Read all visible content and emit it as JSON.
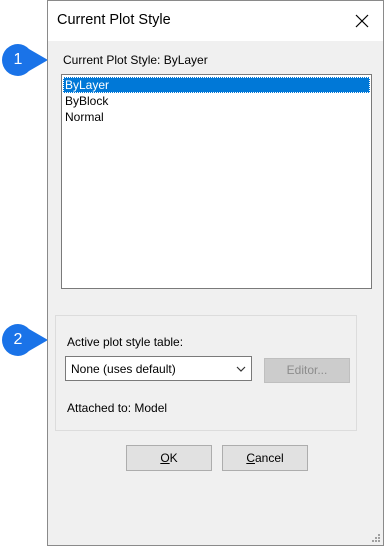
{
  "window": {
    "title": "Current Plot Style"
  },
  "current_style_label": "Current Plot Style: ByLayer",
  "plot_styles": [
    {
      "label": "ByLayer",
      "selected": true
    },
    {
      "label": "ByBlock",
      "selected": false
    },
    {
      "label": "Normal",
      "selected": false
    }
  ],
  "table_group": {
    "label": "Active plot style table:",
    "selected_value": "None (uses default)",
    "editor_label": "Editor...",
    "attached_text": "Attached to: Model"
  },
  "buttons": {
    "ok_label": "OK",
    "cancel_label": "Cancel"
  },
  "callouts": [
    {
      "number": "1"
    },
    {
      "number": "2"
    }
  ],
  "colors": {
    "callout_blue": "#1a73e8",
    "selection_blue": "#0078d7"
  }
}
